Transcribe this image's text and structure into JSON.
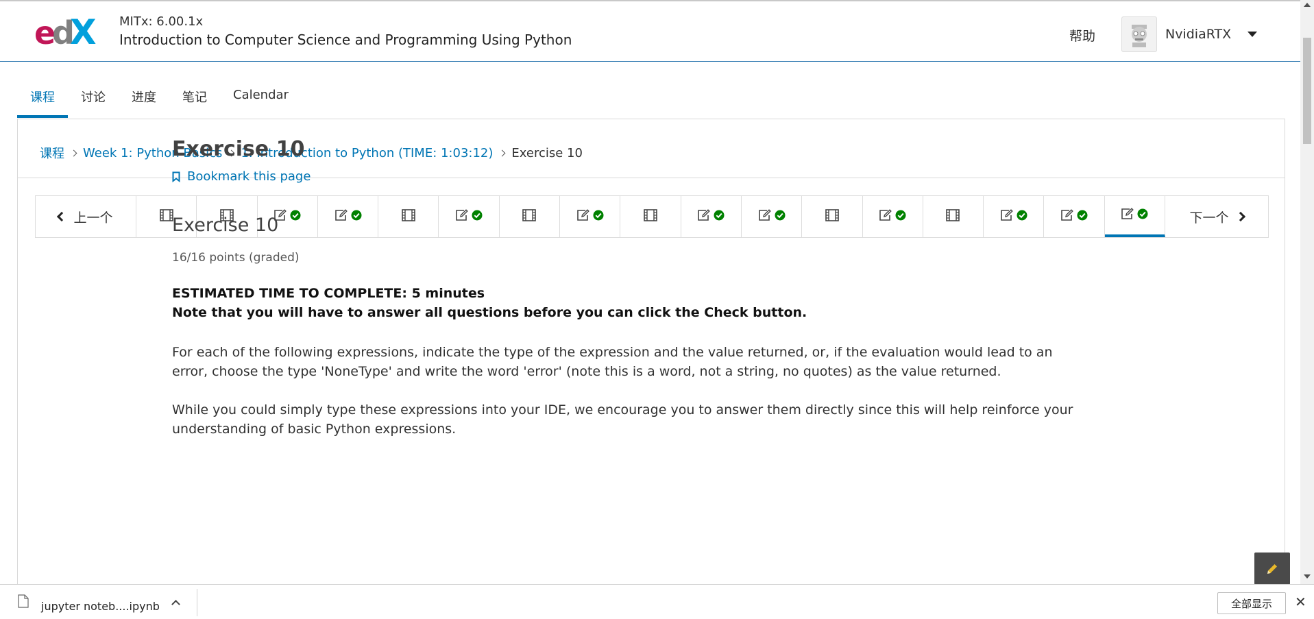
{
  "header": {
    "course_org": "MITx: 6.00.1x",
    "course_title": "Introduction to Computer Science and Programming Using Python",
    "help_label": "帮助",
    "username": "NvidiaRTX"
  },
  "tabs": [
    {
      "label": "课程",
      "active": true
    },
    {
      "label": "讨论",
      "active": false
    },
    {
      "label": "进度",
      "active": false
    },
    {
      "label": "笔记",
      "active": false
    },
    {
      "label": "Calendar",
      "active": false
    }
  ],
  "breadcrumb": {
    "items": [
      "课程",
      "Week 1: Python Basics",
      "1. Introduction to Python (TIME: 1:03:12)"
    ],
    "current": "Exercise 10"
  },
  "sequence": {
    "prev_label": "上一个",
    "next_label": "下一个",
    "items": [
      {
        "icon": "video-icon",
        "complete": false
      },
      {
        "icon": "video-icon",
        "complete": false
      },
      {
        "icon": "problem-icon",
        "complete": true
      },
      {
        "icon": "problem-icon",
        "complete": true
      },
      {
        "icon": "video-icon",
        "complete": false
      },
      {
        "icon": "problem-icon",
        "complete": true
      },
      {
        "icon": "video-icon",
        "complete": false
      },
      {
        "icon": "problem-icon",
        "complete": true
      },
      {
        "icon": "video-icon",
        "complete": false
      },
      {
        "icon": "problem-icon",
        "complete": true
      },
      {
        "icon": "problem-icon",
        "complete": true
      },
      {
        "icon": "video-icon",
        "complete": false
      },
      {
        "icon": "problem-icon",
        "complete": true
      },
      {
        "icon": "video-icon",
        "complete": false
      },
      {
        "icon": "problem-icon",
        "complete": true
      },
      {
        "icon": "problem-icon",
        "complete": true
      },
      {
        "icon": "problem-icon",
        "complete": true,
        "active": true
      }
    ]
  },
  "content": {
    "unit_title": "Exercise 10",
    "bookmark_label": "Bookmark this page",
    "problem_title": "Exercise 10",
    "points": "16/16 points (graded)",
    "estimated_time": "ESTIMATED TIME TO COMPLETE: 5 minutes",
    "note": "Note that you will have to answer all questions before you can click the Check button.",
    "paragraph1": "For each of the following expressions, indicate the type of the expression and the value returned, or, if the evaluation would lead to an error, choose the type 'NoneType' and write the word 'error' (note this is a word, not a string, no quotes) as the value returned.",
    "paragraph2": "While you could simply type these expressions into your IDE, we encourage you to answer them directly since this will help reinforce your understanding of basic Python expressions."
  },
  "download_bar": {
    "file_name": "jupyter noteb....ipynb",
    "show_all_label": "全部显示",
    "close_label": "✕"
  },
  "colors": {
    "accent": "#0075b4",
    "check_green": "#008100",
    "edx_magenta": "#c11657",
    "edx_gray": "#6b6b6b",
    "edx_blue": "#02a0dc"
  }
}
